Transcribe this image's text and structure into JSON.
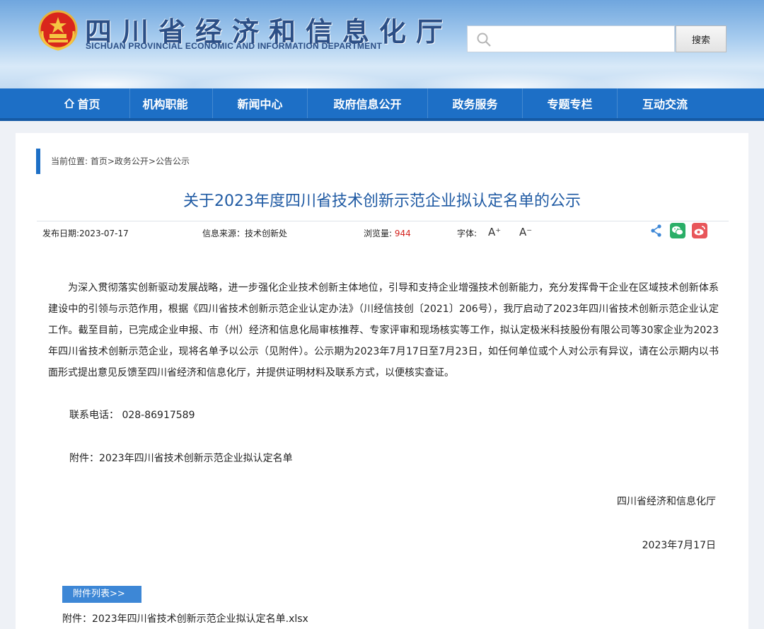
{
  "header": {
    "title": "四川省经济和信息化厅",
    "subtitle": "SICHUAN PROVINCIAL ECONOMIC AND INFORMATION DEPARTMENT",
    "search_placeholder": "",
    "search_button": "搜索"
  },
  "nav": {
    "items": [
      {
        "label": "首页"
      },
      {
        "label": "机构职能"
      },
      {
        "label": "新闻中心"
      },
      {
        "label": "政府信息公开"
      },
      {
        "label": "政务服务"
      },
      {
        "label": "专题专栏"
      },
      {
        "label": "互动交流"
      }
    ]
  },
  "breadcrumb": "当前位置: 首页>政务公开>公告公示",
  "article": {
    "title": "关于2023年度四川省技术创新示范企业拟认定名单的公示",
    "meta": {
      "publish_date": "发布日期:2023-07-17",
      "source": "信息来源：技术创新处",
      "views_label": "浏览量:",
      "views": "944",
      "font_label": "字体:",
      "font_larger": "A⁺",
      "font_smaller": "A⁻"
    },
    "body": "为深入贯彻落实创新驱动发展战略，进一步强化企业技术创新主体地位，引导和支持企业增强技术创新能力，充分发挥骨干企业在区域技术创新体系建设中的引领与示范作用，根据《四川省技术创新示范企业认定办法》（川经信技创〔2021〕206号），我厅启动了2023年四川省技术创新示范企业认定工作。截至目前，已完成企业申报、市（州）经济和信息化局审核推荐、专家评审和现场核实等工作，拟认定极米科技股份有限公司等30家企业为2023年四川省技术创新示范企业，现将名单予以公示（见附件）。公示期为2023年7月17日至7月23日，如任何单位或个人对公示有异议，请在公示期内以书面形式提出意见反馈至四川省经济和信息化厅，并提供证明材料及联系方式，以便核实查证。",
    "contact": "联系电话：  028-86917589",
    "attachment_line": "附件：2023年四川省技术创新示范企业拟认定名单",
    "sign_org": "四川省经济和信息化厅",
    "sign_date": "2023年7月17日"
  },
  "attachments": {
    "tab_label": "附件列表>>",
    "files": [
      "附件：2023年四川省技术创新示范企业拟认定名单.xlsx"
    ]
  },
  "colors": {
    "nav_bg": "#1d6fc6",
    "title_blue": "#1f5aa3",
    "views_red": "#d4231e",
    "wechat_green": "#2aae67",
    "weibo_red": "#e8565a"
  }
}
